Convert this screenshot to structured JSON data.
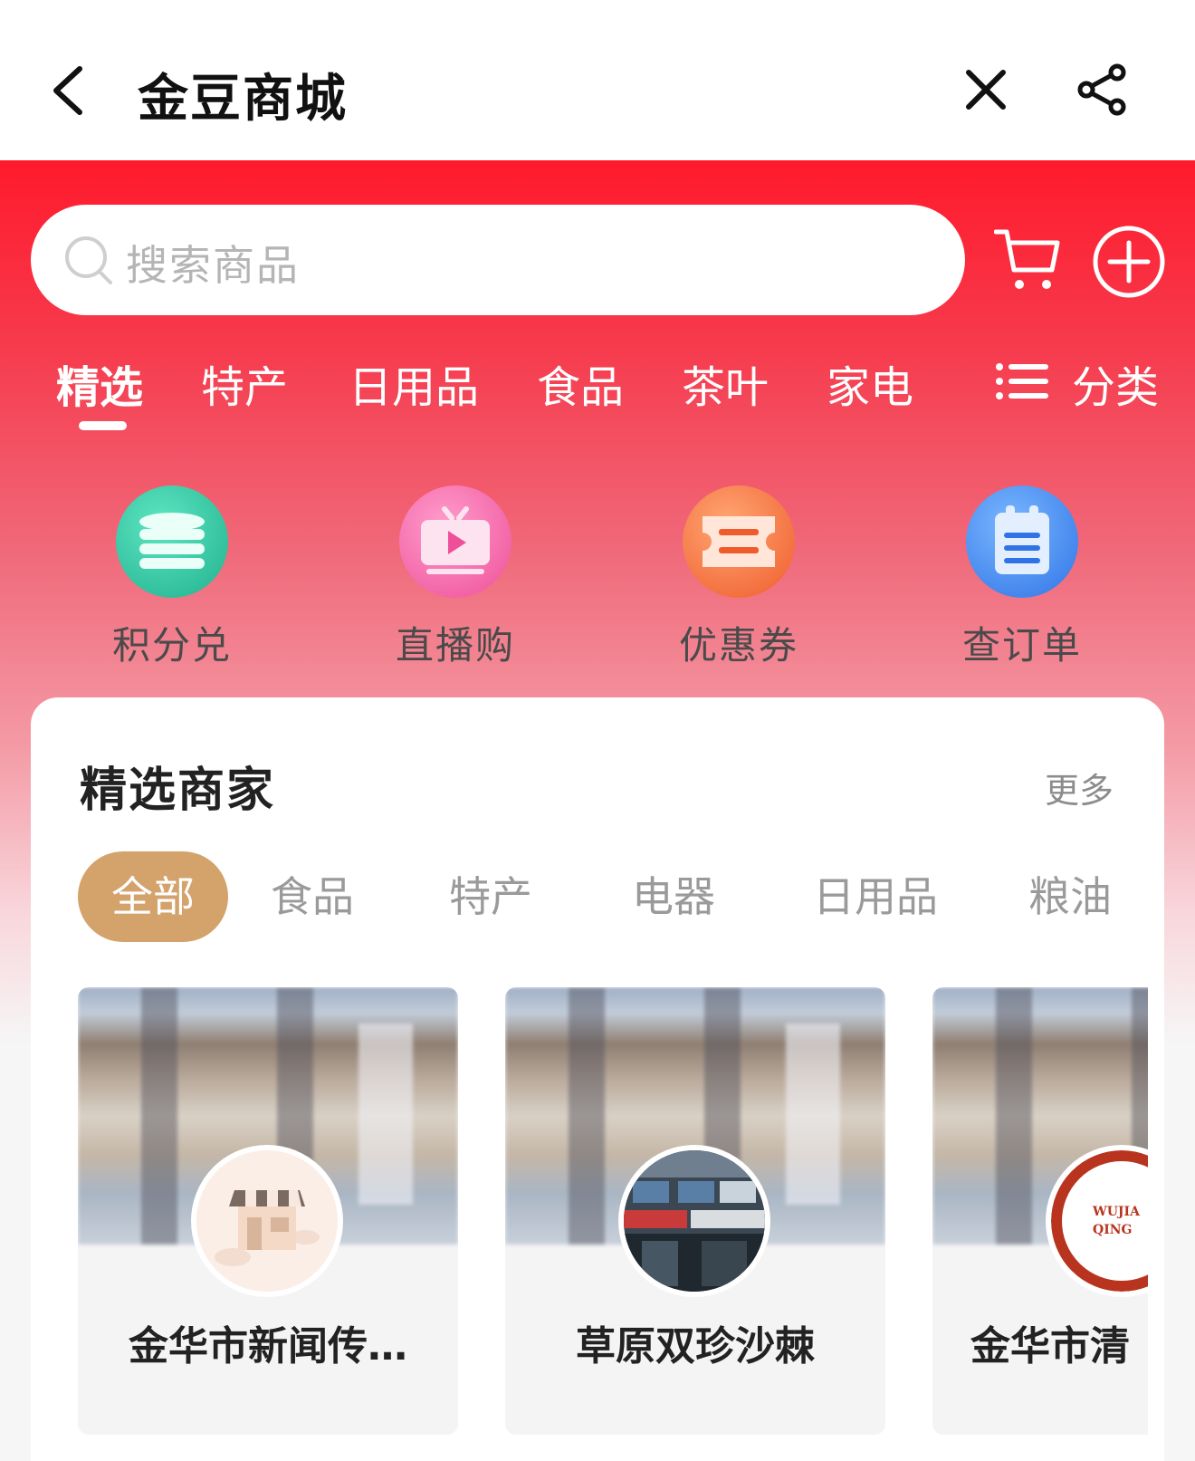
{
  "header": {
    "title": "金豆商城",
    "back_icon": "chevron-left-icon",
    "close_icon": "close-icon",
    "share_icon": "share-icon"
  },
  "search": {
    "placeholder": "搜索商品"
  },
  "tabs": [
    {
      "label": "精选",
      "active": true
    },
    {
      "label": "特产"
    },
    {
      "label": "日用品"
    },
    {
      "label": "食品"
    },
    {
      "label": "茶叶"
    },
    {
      "label": "家电"
    }
  ],
  "classify_label": "分类",
  "quick": [
    {
      "label": "积分兑",
      "icon": "coin-stack-icon",
      "color": "#2ec7a3"
    },
    {
      "label": "直播购",
      "icon": "tv-play-icon",
      "color": "#f05fa2"
    },
    {
      "label": "优惠券",
      "icon": "ticket-icon",
      "color": "#f26b3a"
    },
    {
      "label": "查订单",
      "icon": "clipboard-icon",
      "color": "#3a86f0"
    }
  ],
  "merchants": {
    "title": "精选商家",
    "more": "更多",
    "filters": [
      "全部",
      "食品",
      "特产",
      "电器",
      "日用品",
      "粮油"
    ],
    "stores": [
      {
        "name": "金华市新闻传…"
      },
      {
        "name": "草原双珍沙棘"
      },
      {
        "name": "金华市清"
      }
    ],
    "avatar_texts": [
      "WUJIA",
      "QING"
    ]
  },
  "colors": {
    "brand_red": "#ff1a2c",
    "chip_active": "#d4a26b"
  }
}
